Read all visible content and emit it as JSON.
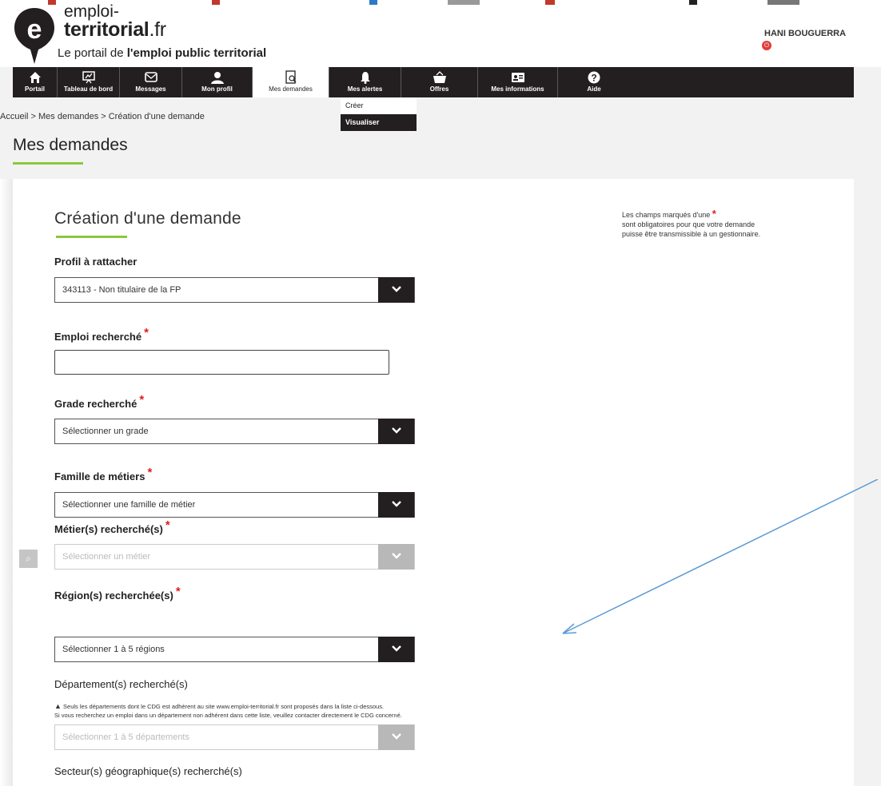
{
  "header": {
    "logo_line1": "emploi-",
    "logo_line2": "territorial",
    "logo_ext": ".fr",
    "tagline_prefix": "Le portail de ",
    "tagline_bold": "l'emploi public territorial",
    "user_name": "HANI BOUGUERRA"
  },
  "nav": {
    "items": [
      {
        "label": "Portail",
        "icon": "home-icon"
      },
      {
        "label": "Tableau de bord",
        "icon": "dashboard-icon"
      },
      {
        "label": "Messages",
        "icon": "envelope-icon"
      },
      {
        "label": "Mon profil",
        "icon": "user-icon"
      },
      {
        "label": "Mes demandes",
        "icon": "document-search-icon"
      },
      {
        "label": "Mes alertes",
        "icon": "bell-icon"
      },
      {
        "label": "Offres",
        "icon": "basket-icon"
      },
      {
        "label": "Mes informations",
        "icon": "id-card-icon"
      },
      {
        "label": "Aide",
        "icon": "help-icon"
      }
    ],
    "dropdown": [
      "Créer",
      "Visualiser"
    ]
  },
  "breadcrumb": "Accueil > Mes demandes > Création d'une demande",
  "page_title": "Mes demandes",
  "form": {
    "title": "Création d'une demande",
    "note_line1": "Les champs marqués d'une",
    "note_line2": "sont obligatoires pour que votre demande",
    "note_line3": "puisse être transmissible à un gestionnaire.",
    "profil_label": "Profil à rattacher",
    "profil_value": "343113 - Non titulaire de la FP",
    "emploi_label": "Emploi recherché",
    "emploi_value": "",
    "grade_label": "Grade recherché",
    "grade_value": "Sélectionner un grade",
    "famille_label": "Famille de métiers",
    "famille_value": "Sélectionner une famille de métier",
    "metier_label": "Métier(s) recherché(s)",
    "metier_value": "Sélectionner un métier",
    "region_label": "Région(s) recherchée(s)",
    "region_value": "Sélectionner 1 à 5 régions",
    "departement_label": "Département(s) recherché(s)",
    "warning_line1": "Seuls les départements dont le CDG est adhérent au site www.emploi-territorial.fr sont proposés dans la liste ci-dessous.",
    "warning_line2": "Si vous recherchez un emploi dans un département non adhérent dans cette liste, veuillez contacter directement le CDG concerné.",
    "departement_value": "Sélectionner 1 à 5 départements",
    "secteur_label": "Secteur(s) géographique(s) recherché(s)"
  },
  "colors": {
    "nav_bg": "#231f20",
    "accent_green": "#8dc63f",
    "required_red": "#e01e1e",
    "annotation_arrow": "#5b9bd5"
  }
}
